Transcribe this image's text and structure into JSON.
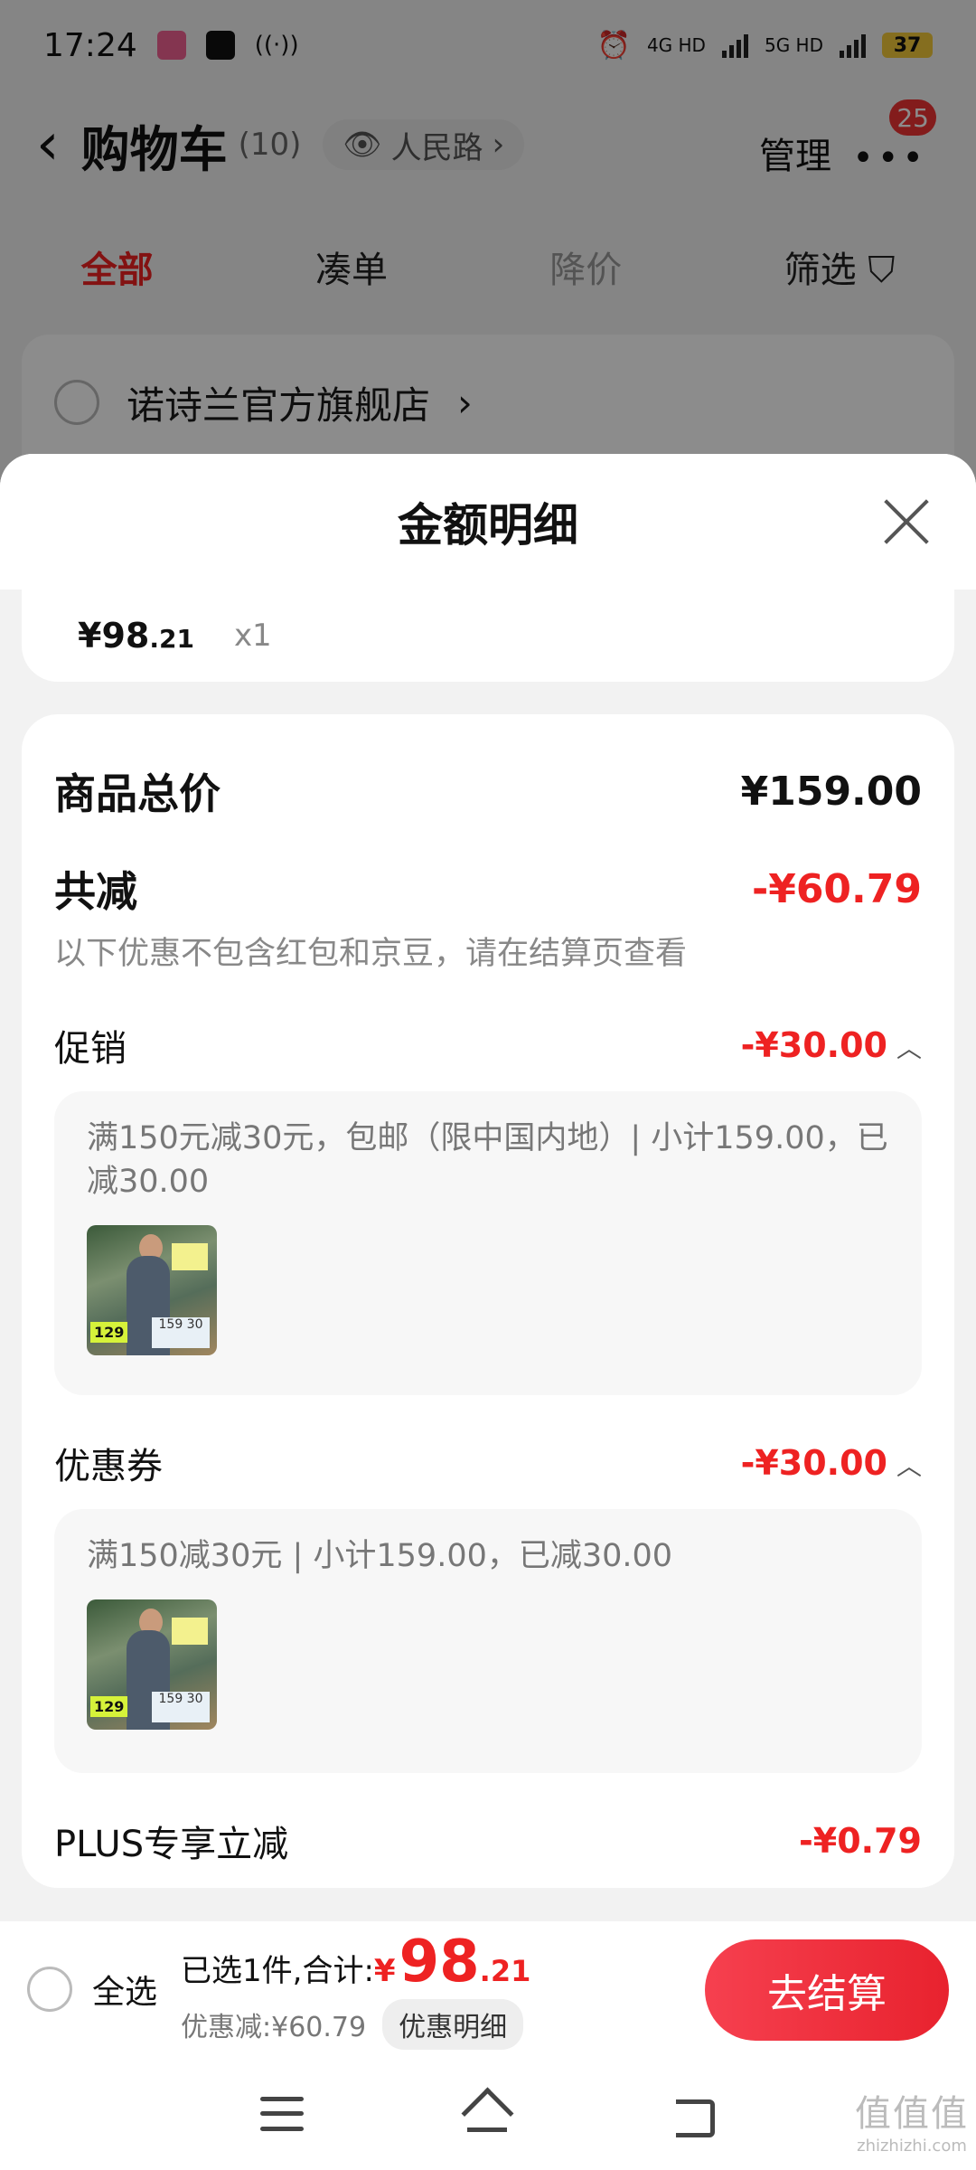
{
  "status": {
    "time": "17:24",
    "net1": "4G HD",
    "net2": "5G HD",
    "battery": "37"
  },
  "header": {
    "title": "购物车",
    "count": "(10)",
    "location": "人民路",
    "manage": "管理",
    "more_badge": "25"
  },
  "tabs": [
    "全部",
    "凑单",
    "降价",
    "筛选"
  ],
  "store": {
    "name": "诺诗兰官方旗舰店"
  },
  "sheet": {
    "title": "金额明细",
    "item": {
      "price_main": "¥98",
      "price_dec": ".21",
      "qty": "x1"
    },
    "total": {
      "label": "商品总价",
      "value": "¥159.00"
    },
    "reduce": {
      "label": "共减",
      "value": "-¥60.79",
      "note": "以下优惠不包含红包和京豆，请在结算页查看"
    },
    "promo": {
      "label": "促销",
      "value": "-¥30.00",
      "text": "满150元减30元，包邮（限中国内地）| 小计159.00，已减30.00"
    },
    "coupon": {
      "label": "优惠券",
      "value": "-¥30.00",
      "text": "满150减30元 | 小计159.00，已减30.00"
    },
    "plus": {
      "label": "PLUS专享立减",
      "value": "-¥0.79"
    },
    "thumb_price": "129",
    "thumb_vals": "159 30"
  },
  "bottom": {
    "select_all": "全选",
    "selected": "已选1件,合计:",
    "yen": "¥",
    "price_main": "98",
    "price_dec": ".21",
    "discount": "优惠减:¥60.79",
    "detail_btn": "优惠明细",
    "checkout": "去结算"
  },
  "watermark": {
    "main": "值值值",
    "sub": "zhizhizhi.com"
  }
}
